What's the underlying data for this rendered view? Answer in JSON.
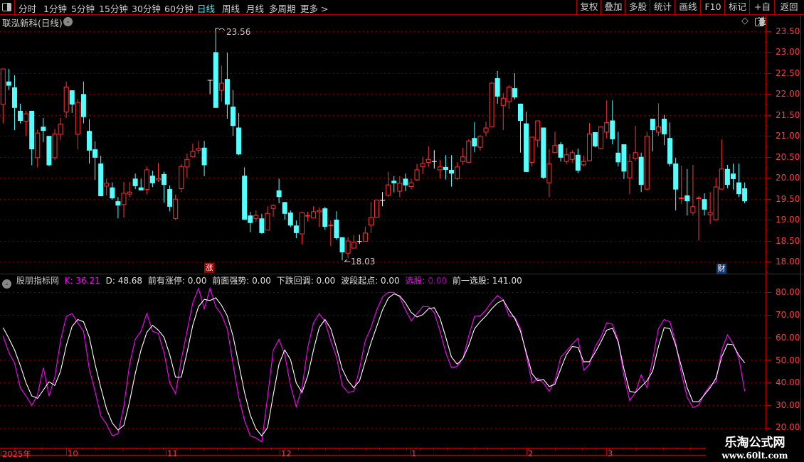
{
  "toolbar": {
    "periods": [
      "分时",
      "1分钟",
      "5分钟",
      "15分钟",
      "30分钟",
      "60分钟",
      "日线",
      "周线",
      "月线",
      "多周期",
      "更多 >"
    ],
    "active_period": "日线",
    "buttons": [
      "复权",
      "叠加",
      "多股",
      "统计",
      "画线",
      "F10",
      "标记",
      "+自选",
      "返回"
    ]
  },
  "chart_title": "联泓新科(日线)",
  "price_axis": [
    "23.50",
    "23.00",
    "22.50",
    "22.00",
    "21.50",
    "21.00",
    "20.50",
    "20.00",
    "19.50",
    "19.00",
    "18.50",
    "18.00"
  ],
  "indicator_axis": [
    "80.00",
    "70.00",
    "60.00",
    "50.00",
    "40.00",
    "30.00",
    "20.00"
  ],
  "annotations": {
    "high": "23.56",
    "low": "18.03"
  },
  "markers": {
    "limit_up": "涨",
    "finance": "财"
  },
  "indicator": {
    "name": "股朋指标网",
    "k_label": "K: 36.21",
    "d_label": "D: 48.68",
    "f1": "前有涨停: 0.00",
    "f2": "前面强势: 0.00",
    "f3": "下跌回调: 0.00",
    "f4": "波段起点: 0.00",
    "f5_name": "选股:",
    "f5_val": "0.00",
    "f6": "前一选股: 141.00"
  },
  "x_axis": [
    "2025年",
    "10",
    "11",
    "12",
    "1",
    "2",
    "3"
  ],
  "watermark": {
    "title": "乐淘公式网",
    "url": "www.60lt.com"
  },
  "colors": {
    "up": "#ff3232",
    "down": "#54ffff",
    "flat": "#ffffff",
    "k_line": "#ff00ff",
    "d_line": "#ffffff",
    "grid": "#8a0000",
    "accent": "#3ff0ff"
  },
  "chart_data": {
    "type": "candlestick",
    "ohlc_format": [
      "open",
      "high",
      "low",
      "close"
    ],
    "ylim": [
      18.0,
      23.5
    ],
    "ohlc": [
      [
        21.75,
        22.6,
        21.3,
        22.6
      ],
      [
        22.3,
        22.6,
        22.1,
        22.2
      ],
      [
        22.16,
        22.45,
        21.14,
        21.67
      ],
      [
        21.6,
        21.77,
        21.3,
        21.36
      ],
      [
        21.35,
        21.6,
        21.0,
        21.53
      ],
      [
        21.6,
        21.6,
        20.3,
        20.68
      ],
      [
        20.48,
        21.15,
        20.25,
        21.07
      ],
      [
        21.22,
        21.43,
        20.85,
        21.12
      ],
      [
        21.0,
        21.0,
        20.28,
        20.3
      ],
      [
        20.48,
        21.17,
        20.43,
        21.05
      ],
      [
        21.04,
        21.43,
        20.9,
        21.28
      ],
      [
        21.57,
        22.3,
        21.43,
        22.17
      ],
      [
        22.09,
        22.09,
        21.55,
        21.75
      ],
      [
        21.04,
        21.88,
        20.68,
        21.8
      ],
      [
        22.0,
        22.3,
        21.3,
        21.45
      ],
      [
        21.12,
        21.4,
        20.34,
        20.65
      ],
      [
        20.68,
        20.87,
        19.95,
        20.48
      ],
      [
        20.34,
        20.53,
        19.56,
        19.56
      ],
      [
        19.8,
        19.98,
        19.58,
        19.87
      ],
      [
        19.77,
        19.89,
        19.48,
        19.51
      ],
      [
        19.44,
        19.54,
        19.03,
        19.34
      ],
      [
        19.36,
        19.9,
        19.05,
        19.63
      ],
      [
        19.61,
        19.9,
        19.54,
        19.66
      ],
      [
        19.98,
        20.1,
        19.73,
        19.8
      ],
      [
        19.77,
        19.98,
        19.7,
        19.7
      ],
      [
        19.72,
        20.27,
        19.61,
        20.19
      ],
      [
        20.05,
        20.17,
        19.78,
        19.87
      ],
      [
        19.95,
        20.36,
        19.9,
        19.98
      ],
      [
        20.09,
        20.15,
        19.41,
        19.83
      ],
      [
        19.73,
        19.82,
        19.2,
        19.31
      ],
      [
        19.03,
        19.6,
        19.0,
        19.49
      ],
      [
        19.74,
        20.33,
        19.66,
        20.27
      ],
      [
        20.26,
        20.58,
        20.0,
        20.44
      ],
      [
        20.5,
        20.82,
        20.5,
        20.63
      ],
      [
        20.66,
        20.88,
        20.58,
        20.7
      ],
      [
        20.72,
        20.88,
        20.04,
        20.3
      ],
      [
        22.33,
        22.33,
        22.0,
        22.33
      ],
      [
        23.0,
        23.56,
        21.67,
        21.67
      ],
      [
        22.09,
        22.68,
        21.82,
        22.26
      ],
      [
        22.36,
        22.99,
        21.41,
        21.75
      ],
      [
        21.7,
        22.1,
        21.0,
        21.24
      ],
      [
        21.2,
        21.55,
        20.54,
        20.56
      ],
      [
        20.05,
        20.25,
        19.0,
        19.0
      ],
      [
        19.1,
        19.19,
        18.7,
        18.92
      ],
      [
        19.03,
        19.22,
        18.95,
        19.1
      ],
      [
        19.03,
        19.14,
        18.66,
        18.68
      ],
      [
        18.75,
        19.32,
        18.75,
        19.15
      ],
      [
        19.27,
        19.37,
        19.07,
        19.34
      ],
      [
        19.7,
        19.98,
        19.39,
        19.54
      ],
      [
        19.42,
        19.42,
        19.0,
        19.14
      ],
      [
        19.17,
        19.22,
        18.82,
        18.86
      ],
      [
        18.86,
        18.98,
        18.56,
        18.68
      ],
      [
        18.66,
        19.19,
        18.41,
        19.17
      ],
      [
        19.09,
        19.19,
        18.96,
        19.1
      ],
      [
        19.04,
        19.32,
        19.04,
        19.19
      ],
      [
        19.19,
        19.29,
        18.83,
        19.22
      ],
      [
        19.27,
        19.31,
        18.76,
        18.83
      ],
      [
        18.86,
        18.98,
        18.37,
        18.87
      ],
      [
        19.0,
        19.2,
        18.52,
        18.56
      ],
      [
        18.58,
        18.58,
        18.03,
        18.22
      ],
      [
        18.2,
        18.58,
        18.08,
        18.49
      ],
      [
        18.32,
        18.63,
        18.32,
        18.46
      ],
      [
        18.48,
        18.64,
        18.42,
        18.48
      ],
      [
        18.48,
        18.83,
        18.48,
        18.68
      ],
      [
        18.87,
        19.42,
        18.68,
        19.05
      ],
      [
        19.06,
        19.47,
        19.06,
        19.47
      ],
      [
        19.46,
        19.66,
        19.32,
        19.46
      ],
      [
        19.58,
        20.14,
        19.54,
        19.83
      ],
      [
        19.93,
        20.04,
        19.65,
        19.87
      ],
      [
        19.68,
        20.04,
        19.54,
        19.87
      ],
      [
        19.98,
        20.1,
        19.68,
        19.82
      ],
      [
        19.79,
        19.98,
        19.72,
        19.88
      ],
      [
        19.95,
        20.33,
        19.92,
        20.19
      ],
      [
        20.27,
        20.5,
        20.09,
        20.34
      ],
      [
        20.37,
        20.75,
        20.26,
        20.44
      ],
      [
        20.39,
        20.66,
        20.22,
        20.39
      ],
      [
        20.19,
        20.43,
        19.98,
        20.26
      ],
      [
        20.26,
        20.54,
        19.96,
        20.19
      ],
      [
        20.19,
        20.54,
        19.79,
        20.1
      ],
      [
        19.98,
        20.37,
        19.95,
        20.26
      ],
      [
        20.39,
        20.72,
        20.31,
        20.5
      ],
      [
        20.37,
        20.92,
        20.37,
        20.88
      ],
      [
        20.95,
        21.33,
        20.61,
        20.75
      ],
      [
        20.73,
        21.02,
        20.65,
        20.99
      ],
      [
        21.09,
        21.34,
        20.99,
        21.19
      ],
      [
        21.22,
        22.29,
        21.22,
        22.26
      ],
      [
        22.38,
        22.55,
        21.77,
        21.94
      ],
      [
        21.73,
        22.02,
        21.14,
        21.9
      ],
      [
        21.82,
        22.21,
        21.65,
        22.17
      ],
      [
        22.14,
        22.5,
        21.87,
        21.92
      ],
      [
        21.77,
        21.77,
        20.6,
        21.36
      ],
      [
        21.3,
        21.58,
        20.14,
        20.14
      ],
      [
        20.37,
        20.97,
        20.27,
        20.97
      ],
      [
        20.9,
        21.36,
        20.73,
        21.36
      ],
      [
        21.2,
        21.2,
        19.97,
        20.0
      ],
      [
        19.88,
        20.68,
        19.54,
        20.33
      ],
      [
        20.6,
        21.1,
        20.6,
        20.77
      ],
      [
        20.8,
        20.85,
        20.39,
        20.48
      ],
      [
        20.39,
        20.72,
        20.33,
        20.55
      ],
      [
        20.44,
        20.66,
        20.36,
        20.6
      ],
      [
        20.55,
        20.7,
        20.12,
        20.17
      ],
      [
        20.31,
        20.53,
        20.27,
        20.39
      ],
      [
        20.41,
        21.31,
        20.41,
        21.05
      ],
      [
        21.09,
        21.09,
        20.73,
        20.75
      ],
      [
        20.7,
        21.22,
        20.68,
        21.22
      ],
      [
        21.09,
        21.85,
        20.94,
        21.32
      ],
      [
        21.37,
        21.85,
        20.8,
        20.92
      ],
      [
        20.6,
        21.1,
        20.27,
        20.37
      ],
      [
        20.8,
        20.8,
        19.97,
        20.15
      ],
      [
        20.0,
        20.56,
        19.61,
        20.39
      ],
      [
        20.46,
        21.24,
        20.41,
        20.6
      ],
      [
        20.5,
        20.6,
        19.66,
        19.83
      ],
      [
        19.73,
        21.1,
        19.7,
        20.99
      ],
      [
        21.41,
        21.41,
        20.63,
        21.14
      ],
      [
        21.09,
        21.78,
        21.0,
        21.22
      ],
      [
        21.41,
        21.5,
        20.78,
        21.04
      ],
      [
        20.95,
        21.32,
        20.27,
        20.33
      ],
      [
        20.34,
        20.48,
        19.22,
        19.72
      ],
      [
        19.51,
        20.29,
        19.38,
        19.52
      ],
      [
        19.58,
        20.21,
        19.1,
        19.44
      ],
      [
        19.17,
        20.31,
        19.1,
        19.31
      ],
      [
        19.51,
        19.56,
        18.5,
        19.52
      ],
      [
        19.49,
        19.63,
        19.1,
        19.24
      ],
      [
        19.12,
        19.66,
        18.9,
        19.17
      ],
      [
        19.0,
        20.0,
        18.97,
        19.78
      ],
      [
        19.73,
        20.92,
        19.72,
        20.21
      ],
      [
        20.21,
        20.31,
        19.75,
        19.83
      ],
      [
        20.1,
        20.34,
        19.72,
        19.97
      ],
      [
        19.89,
        20.34,
        19.54,
        19.61
      ],
      [
        19.75,
        19.89,
        19.39,
        19.44
      ]
    ],
    "indicator": {
      "type": "line",
      "ylim": [
        15,
        85
      ],
      "series": [
        {
          "name": "K",
          "values": [
            60.6,
            53.3,
            48.6,
            37.7,
            34.1,
            29.9,
            34.6,
            46.6,
            34.1,
            42.4,
            58.5,
            69.3,
            70.5,
            66.4,
            62.7,
            46.0,
            36.1,
            25.2,
            21.6,
            16.4,
            17.4,
            29.4,
            48.1,
            59.1,
            62.7,
            70.5,
            62.7,
            61.7,
            53.3,
            39.8,
            35.1,
            50.2,
            62.7,
            75.2,
            81.7,
            72.6,
            81.7,
            73.6,
            70.0,
            63.8,
            48.1,
            33.5,
            23.1,
            16.4,
            15.5,
            13.8,
            33.5,
            54.4,
            59.1,
            52.3,
            38.7,
            29.4,
            37.7,
            55.4,
            66.4,
            70.5,
            66.9,
            58.5,
            51.3,
            38.7,
            35.6,
            36.1,
            46.0,
            58.5,
            64.3,
            72.1,
            77.8,
            79.9,
            79.9,
            77.8,
            72.1,
            67.4,
            70.5,
            73.6,
            73.6,
            71.0,
            62.7,
            53.3,
            46.6,
            47.1,
            50.7,
            60.6,
            69.2,
            69.5,
            72.1,
            75.7,
            78.5,
            76.5,
            69.5,
            69.0,
            63.8,
            52.3,
            39.8,
            41.9,
            39.8,
            36.1,
            40.8,
            51.3,
            53.9,
            57.0,
            59.6,
            45.5,
            48.1,
            55.9,
            60.1,
            66.4,
            65.8,
            58.5,
            42.9,
            32.0,
            35.6,
            43.4,
            37.7,
            50.2,
            63.8,
            67.9,
            66.9,
            57.5,
            44.0,
            33.5,
            28.9,
            30.0,
            35.1,
            38.7,
            40.3,
            54.4,
            61.1,
            57.0,
            50.7,
            36.2
          ]
        },
        {
          "name": "D",
          "values": [
            64.3,
            59.6,
            54.4,
            47.6,
            39.8,
            34.1,
            33.0,
            36.7,
            40.3,
            38.7,
            45.0,
            56.4,
            64.8,
            67.9,
            66.9,
            60.1,
            48.1,
            37.7,
            28.3,
            22.1,
            19.0,
            21.0,
            31.5,
            44.0,
            54.4,
            62.2,
            65.3,
            63.2,
            60.1,
            52.3,
            42.4,
            42.4,
            53.3,
            65.3,
            73.6,
            76.8,
            76.3,
            77.5,
            74.2,
            69.5,
            60.6,
            48.1,
            35.6,
            25.7,
            19.5,
            16.4,
            20.0,
            34.6,
            48.1,
            54.4,
            50.2,
            39.8,
            35.6,
            42.9,
            54.4,
            64.3,
            67.9,
            63.8,
            55.4,
            46.0,
            40.8,
            37.7,
            40.8,
            49.2,
            57.5,
            64.8,
            72.1,
            77.3,
            79.2,
            78.3,
            75.2,
            71.0,
            69.0,
            70.0,
            72.6,
            73.1,
            68.4,
            60.1,
            51.3,
            48.1,
            50.7,
            56.4,
            63.8,
            66.9,
            69.5,
            72.6,
            75.2,
            76.5,
            72.1,
            68.4,
            62.7,
            53.3,
            44.0,
            40.8,
            41.4,
            38.2,
            39.3,
            46.0,
            52.3,
            55.9,
            55.6,
            49.2,
            49.2,
            53.3,
            58.0,
            63.2,
            64.0,
            58.0,
            46.0,
            36.1,
            35.6,
            38.2,
            40.8,
            45.0,
            55.9,
            64.3,
            63.8,
            56.4,
            47.1,
            37.7,
            31.5,
            31.5,
            34.6,
            37.7,
            41.9,
            51.3,
            57.0,
            56.7,
            52.0,
            48.7
          ]
        }
      ]
    }
  }
}
